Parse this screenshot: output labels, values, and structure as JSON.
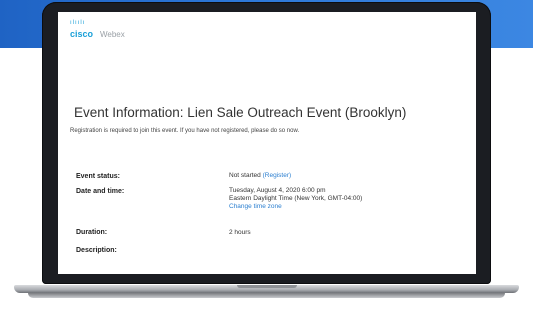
{
  "brand": {
    "cisco_bars": "ılıılı",
    "cisco": "cisco",
    "webex": "Webex"
  },
  "event": {
    "title": "Event Information: Lien Sale Outreach Event (Brooklyn)",
    "registration_note": "Registration is required to join this event. If you have not registered, please do so now."
  },
  "details": {
    "status_label": "Event status:",
    "status_value": "Not started",
    "register_link": "(Register)",
    "datetime_label": "Date and time:",
    "datetime_line1": "Tuesday, August 4, 2020 6:00 pm",
    "datetime_line2": "Eastern Daylight Time (New York, GMT-04:00)",
    "change_timezone_link": "Change time zone",
    "duration_label": "Duration:",
    "duration_value": "2 hours",
    "description_label": "Description:"
  },
  "colors": {
    "background_band": "#2d78d8",
    "webex_blue": "#1ba0d8",
    "link": "#2b7fd0",
    "laptop_bezel": "#1b1d22"
  }
}
